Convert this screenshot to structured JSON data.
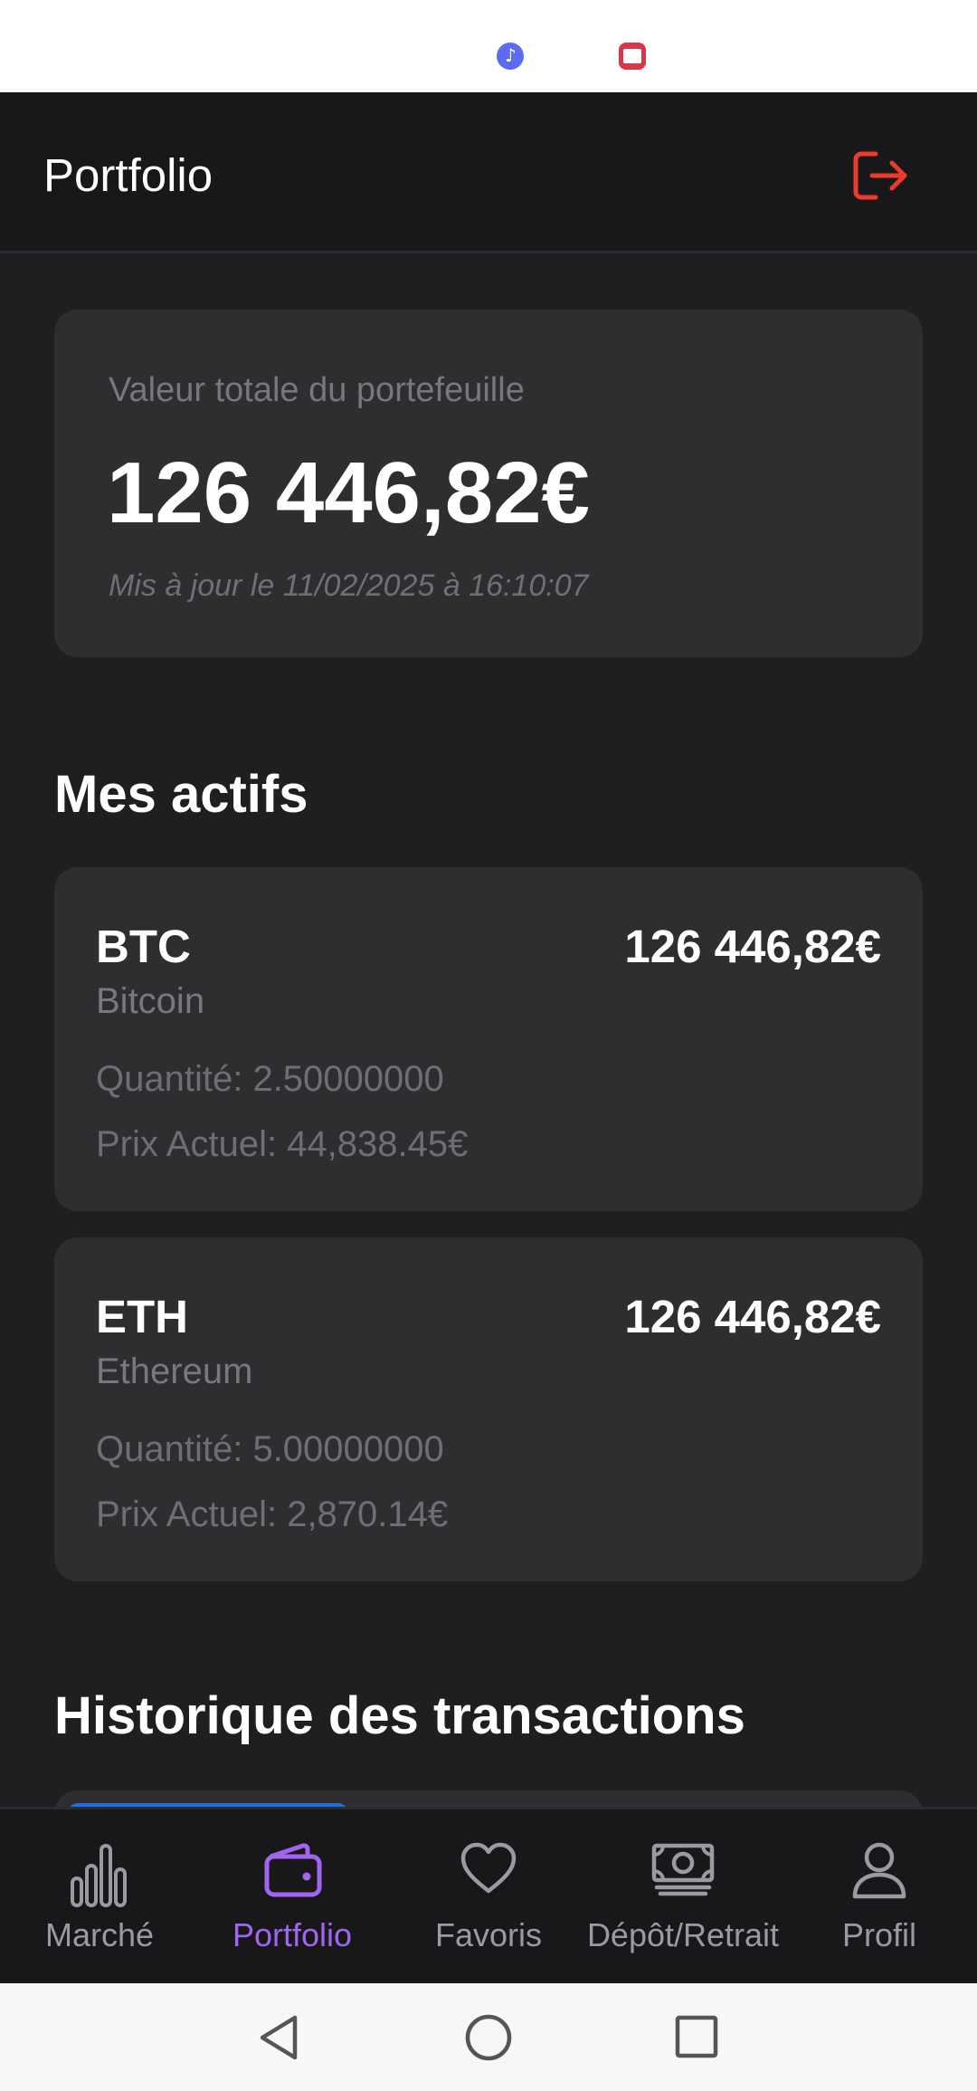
{
  "app": {
    "title": "Portfolio"
  },
  "summary": {
    "label": "Valeur totale du portefeuille",
    "value": "126 446,82€",
    "updated": "Mis à jour le 11/02/2025 à 16:10:07"
  },
  "assets_section": {
    "title": "Mes actifs"
  },
  "assets": [
    {
      "symbol": "BTC",
      "name": "Bitcoin",
      "value": "126 446,82€",
      "quantity": "Quantité: 2.50000000",
      "price": "Prix Actuel: 44,838.45€"
    },
    {
      "symbol": "ETH",
      "name": "Ethereum",
      "value": "126 446,82€",
      "quantity": "Quantité: 5.00000000",
      "price": "Prix Actuel: 2,870.14€"
    }
  ],
  "history_section": {
    "title": "Historique des transactions"
  },
  "nav": {
    "items": [
      {
        "label": "Marché",
        "icon": "bar-chart-icon"
      },
      {
        "label": "Portfolio",
        "icon": "wallet-icon",
        "active": true
      },
      {
        "label": "Favoris",
        "icon": "heart-icon"
      },
      {
        "label": "Dépôt/Retrait",
        "icon": "cash-icon"
      },
      {
        "label": "Profil",
        "icon": "user-icon"
      }
    ]
  },
  "colors": {
    "accent": "#a066ef",
    "logout": "#ee3a2c",
    "background": "#1f1f21",
    "card": "#2e2e30"
  }
}
